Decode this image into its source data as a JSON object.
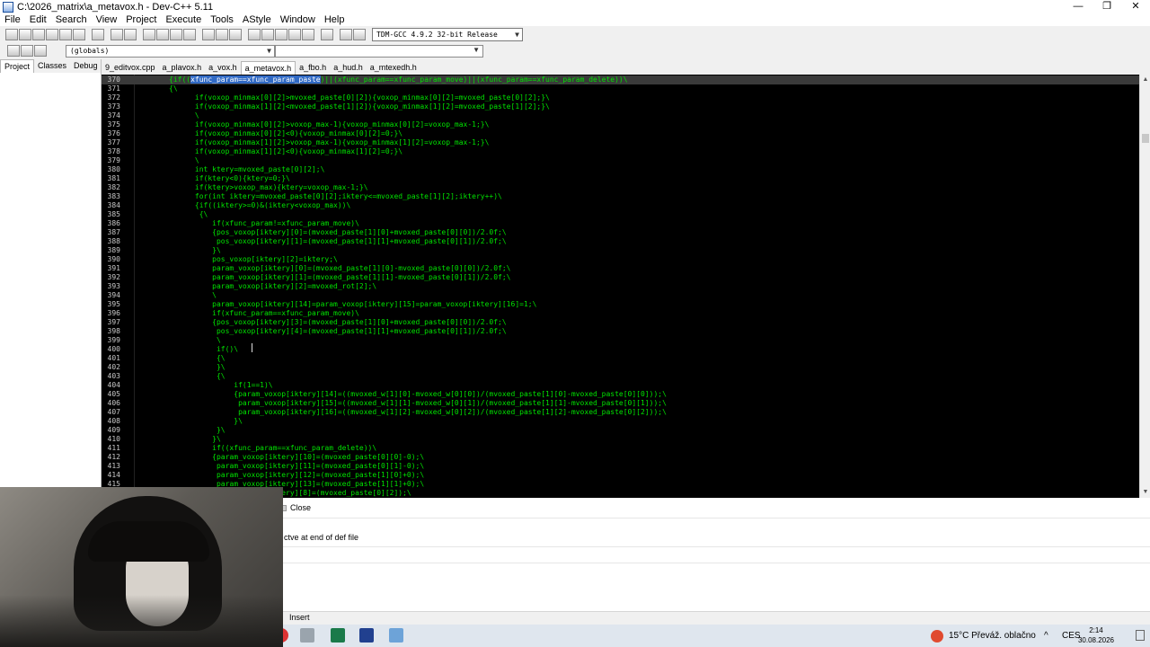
{
  "window": {
    "title": "C:\\2026_matrix\\a_metavox.h - Dev-C++ 5.11",
    "controls": [
      "—",
      "❐",
      "✕"
    ]
  },
  "menu": [
    "File",
    "Edit",
    "Search",
    "View",
    "Project",
    "Execute",
    "Tools",
    "AStyle",
    "Window",
    "Help"
  ],
  "toolbar": {
    "compiler": "TDM-GCC 4.9.2 32-bit Release",
    "scope": "(globals)"
  },
  "left_tabs": [
    "Project",
    "Classes",
    "Debug"
  ],
  "editor_tabs": [
    "9_editvox.cpp",
    "a_plavox.h",
    "a_vox.h",
    "a_metavox.h",
    "a_fbo.h",
    "a_hud.h",
    "a_mtexedh.h"
  ],
  "active_editor_tab": "a_metavox.h",
  "code_lines": [
    {
      "n": "370",
      "pre": "{if((",
      "sel": "xfunc_param==xfunc_param_paste",
      "post": ")||(xfunc_param==xfunc_param_move)||(xfunc_param==xfunc_param_delete))\\"
    },
    {
      "n": "371",
      "t": "{\\"
    },
    {
      "n": "372",
      "t": "      if(voxop_minmax[0][2]>mvoxed_paste[0][2]){voxop_minmax[0][2]=mvoxed_paste[0][2];}\\"
    },
    {
      "n": "373",
      "t": "      if(voxop_minmax[1][2]<mvoxed_paste[1][2]){voxop_minmax[1][2]=mvoxed_paste[1][2];}\\"
    },
    {
      "n": "374",
      "t": "      \\"
    },
    {
      "n": "375",
      "t": "      if(voxop_minmax[0][2]>voxop_max-1){voxop_minmax[0][2]=voxop_max-1;}\\"
    },
    {
      "n": "376",
      "t": "      if(voxop_minmax[0][2]<0){voxop_minmax[0][2]=0;}\\"
    },
    {
      "n": "377",
      "t": "      if(voxop_minmax[1][2]>voxop_max-1){voxop_minmax[1][2]=voxop_max-1;}\\"
    },
    {
      "n": "378",
      "t": "      if(voxop_minmax[1][2]<0){voxop_minmax[1][2]=0;}\\"
    },
    {
      "n": "379",
      "t": "      \\"
    },
    {
      "n": "380",
      "t": "      int ktery=mvoxed_paste[0][2];\\"
    },
    {
      "n": "381",
      "t": "      if(ktery<0){ktery=0;}\\"
    },
    {
      "n": "382",
      "t": "      if(ktery>voxop_max){ktery=voxop_max-1;}\\"
    },
    {
      "n": "383",
      "t": "      for(int iktery=mvoxed_paste[0][2];iktery<=mvoxed_paste[1][2];iktery++)\\"
    },
    {
      "n": "384",
      "t": "      {if((iktery>=0)&(iktery<voxop_max))\\"
    },
    {
      "n": "385",
      "t": "       {\\"
    },
    {
      "n": "386",
      "t": "          if(xfunc_param!=xfunc_param_move)\\"
    },
    {
      "n": "387",
      "t": "          {pos_voxop[iktery][0]=(mvoxed_paste[1][0]+mvoxed_paste[0][0])/2.0f;\\"
    },
    {
      "n": "388",
      "t": "           pos_voxop[iktery][1]=(mvoxed_paste[1][1]+mvoxed_paste[0][1])/2.0f;\\"
    },
    {
      "n": "389",
      "t": "          }\\"
    },
    {
      "n": "390",
      "t": "          pos_voxop[iktery][2]=iktery;\\"
    },
    {
      "n": "391",
      "t": "          param_voxop[iktery][0]=(mvoxed_paste[1][0]-mvoxed_paste[0][0])/2.0f;\\"
    },
    {
      "n": "392",
      "t": "          param_voxop[iktery][1]=(mvoxed_paste[1][1]-mvoxed_paste[0][1])/2.0f;\\"
    },
    {
      "n": "393",
      "t": "          param_voxop[iktery][2]=mvoxed_rot[2];\\"
    },
    {
      "n": "394",
      "t": "          \\"
    },
    {
      "n": "395",
      "t": "          param_voxop[iktery][14]=param_voxop[iktery][15]=param_voxop[iktery][16]=1;\\"
    },
    {
      "n": "396",
      "t": "          if(xfunc_param==xfunc_param_move)\\"
    },
    {
      "n": "397",
      "t": "          {pos_voxop[iktery][3]=(mvoxed_paste[1][0]+mvoxed_paste[0][0])/2.0f;\\"
    },
    {
      "n": "398",
      "t": "           pos_voxop[iktery][4]=(mvoxed_paste[1][1]+mvoxed_paste[0][1])/2.0f;\\"
    },
    {
      "n": "399",
      "t": "           \\"
    },
    {
      "n": "400",
      "t": "           if()\\"
    },
    {
      "n": "401",
      "t": "           {\\"
    },
    {
      "n": "402",
      "t": "           }\\"
    },
    {
      "n": "403",
      "t": "           {\\"
    },
    {
      "n": "404",
      "t": "               if(1==1)\\"
    },
    {
      "n": "405",
      "t": "               {param_voxop[iktery][14]=((mvoxed_w[1][0]-mvoxed_w[0][0])/(mvoxed_paste[1][0]-mvoxed_paste[0][0]));\\"
    },
    {
      "n": "406",
      "t": "                param_voxop[iktery][15]=((mvoxed_w[1][1]-mvoxed_w[0][1])/(mvoxed_paste[1][1]-mvoxed_paste[0][1]));\\"
    },
    {
      "n": "407",
      "t": "                param_voxop[iktery][16]=((mvoxed_w[1][2]-mvoxed_w[0][2])/(mvoxed_paste[1][2]-mvoxed_paste[0][2]));\\"
    },
    {
      "n": "408",
      "t": "               }\\"
    },
    {
      "n": "409",
      "t": "           }\\"
    },
    {
      "n": "410",
      "t": "          }\\"
    },
    {
      "n": "411",
      "t": "          if((xfunc_param==xfunc_param_delete))\\"
    },
    {
      "n": "412",
      "t": "          {param_voxop[iktery][10]=(mvoxed_paste[0][0]-0);\\"
    },
    {
      "n": "413",
      "t": "           param_voxop[iktery][11]=(mvoxed_paste[0][1]-0);\\"
    },
    {
      "n": "414",
      "t": "           param_voxop[iktery][12]=(mvoxed_paste[1][0]+0);\\"
    },
    {
      "n": "415",
      "t": "           param_voxop[iktery][13]=(mvoxed_paste[1][1]+0);\\"
    },
    {
      "n": "",
      "t": "           param_voxop[iktery][8]=(mvoxed_paste[0][2]);\\"
    }
  ],
  "bottom_panel": {
    "close_label": "Close",
    "message": "ctve at end of def file"
  },
  "status": {
    "mode": "Insert"
  },
  "tray": {
    "weather": "15°C  Převáž. oblačno",
    "language": "CES",
    "time": "2:14",
    "date": "30.08.2026"
  },
  "colors": {
    "editor_bg": "#000000",
    "code_fg": "#00e400",
    "line_number": "#c8c8c8",
    "selection": "#316ac5",
    "active_line": "#3a3a3a"
  }
}
